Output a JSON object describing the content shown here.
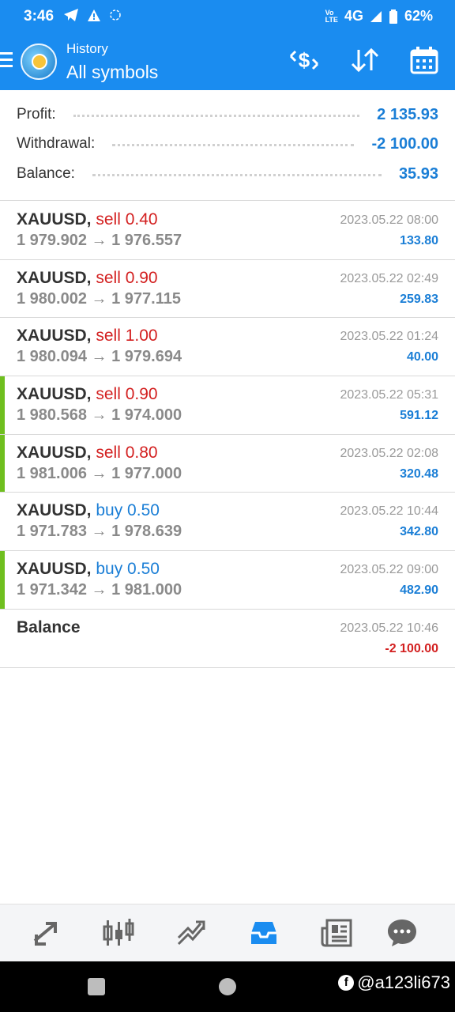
{
  "status_bar": {
    "time": "3:46",
    "network": "4G",
    "battery": "62%"
  },
  "app_bar": {
    "subtitle": "History",
    "title": "All symbols"
  },
  "summary": {
    "profit_label": "Profit:",
    "profit_value": "2 135.93",
    "withdrawal_label": "Withdrawal:",
    "withdrawal_value": "-2 100.00",
    "balance_label": "Balance:",
    "balance_value": "35.93"
  },
  "deals": [
    {
      "symbol": "XAUUSD,",
      "side": "sell",
      "side_text": "sell 0.40",
      "prices": "1 979.902 → 1 976.557",
      "time": "2023.05.22 08:00",
      "profit": "133.80",
      "marked": false
    },
    {
      "symbol": "XAUUSD,",
      "side": "sell",
      "side_text": "sell 0.90",
      "prices": "1 980.002 → 1 977.115",
      "time": "2023.05.22 02:49",
      "profit": "259.83",
      "marked": false
    },
    {
      "symbol": "XAUUSD,",
      "side": "sell",
      "side_text": "sell 1.00",
      "prices": "1 980.094 → 1 979.694",
      "time": "2023.05.22 01:24",
      "profit": "40.00",
      "marked": false
    },
    {
      "symbol": "XAUUSD,",
      "side": "sell",
      "side_text": "sell 0.90",
      "prices": "1 980.568 → 1 974.000",
      "time": "2023.05.22 05:31",
      "profit": "591.12",
      "marked": true
    },
    {
      "symbol": "XAUUSD,",
      "side": "sell",
      "side_text": "sell 0.80",
      "prices": "1 981.006 → 1 977.000",
      "time": "2023.05.22 02:08",
      "profit": "320.48",
      "marked": true
    },
    {
      "symbol": "XAUUSD,",
      "side": "buy",
      "side_text": "buy 0.50",
      "prices": "1 971.783 → 1 978.639",
      "time": "2023.05.22 10:44",
      "profit": "342.80",
      "marked": false
    },
    {
      "symbol": "XAUUSD,",
      "side": "buy",
      "side_text": "buy 0.50",
      "prices": "1 971.342 → 1 981.000",
      "time": "2023.05.22 09:00",
      "profit": "482.90",
      "marked": true
    }
  ],
  "balance_op": {
    "label": "Balance",
    "time": "2023.05.22 10:46",
    "amount": "-2 100.00"
  },
  "bottom_nav": [
    {
      "icon": "quotes-icon",
      "active": false
    },
    {
      "icon": "chart-candles-icon",
      "active": false
    },
    {
      "icon": "trade-icon",
      "active": false
    },
    {
      "icon": "history-inbox-icon",
      "active": true
    },
    {
      "icon": "news-icon",
      "active": false
    },
    {
      "icon": "chat-icon",
      "active": false
    }
  ],
  "watermark": "@a123li673",
  "colors": {
    "primary": "#1a8cf0",
    "sell": "#d32020",
    "buy": "#1a7ed6",
    "marker": "#6fbf1f"
  }
}
